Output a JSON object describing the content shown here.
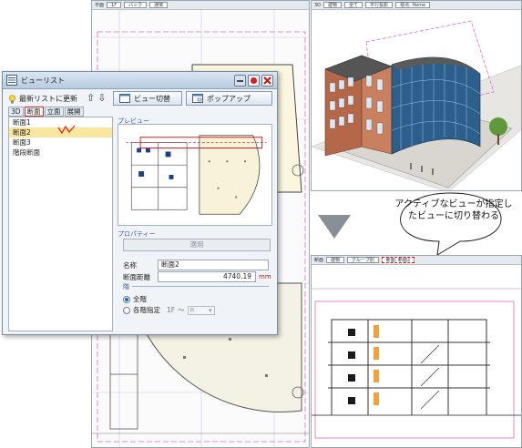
{
  "plan_window": {
    "title": "平面",
    "floor": "1F",
    "back_label": "バック",
    "mode_label": "通常"
  },
  "td_window": {
    "title": "3D",
    "building_label": "建物",
    "all_label": "全て",
    "projection_label": "平行投影",
    "viewpoint_label": "視点: Home"
  },
  "section_window": {
    "title": "断面",
    "building_label": "建物",
    "group_label": "グループ別",
    "active_view_label": "断面: 断面2"
  },
  "balloon": {
    "text": "アクティブなビューが指定したビューに切り替わる"
  },
  "dialog": {
    "title": "ビューリスト",
    "refresh_label": "最新リストに更新",
    "view_switch_label": "ビュー切替",
    "popup_label": "ポップアップ",
    "tabs": [
      "3D",
      "断面",
      "立面",
      "展開"
    ],
    "active_tab": "断面",
    "list_items": [
      "断面1",
      "断面2",
      "断面3",
      "階段断面"
    ],
    "selected_item": "断面2",
    "preview_label": "プレビュー",
    "property_label": "プロパティー",
    "apply_label": "適用",
    "name_label": "名称",
    "name_value": "断面2",
    "distance_label": "断面距離",
    "distance_value": "4740.19",
    "distance_unit": "mm",
    "floor_label": "階",
    "all_floors_label": "全階",
    "each_floor_label": "各階指定",
    "floor_from": "1F",
    "floor_sep": "〜",
    "floor_to": "R"
  }
}
